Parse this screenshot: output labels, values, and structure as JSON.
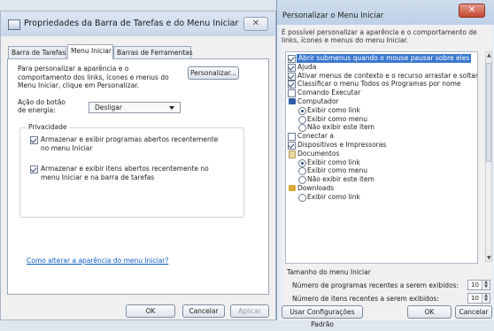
{
  "taskbar_dialog": {
    "title": "Propriedades da Barra de Tarefas e do Menu Iniciar",
    "close": "✕",
    "tabs": [
      "Barra de Tarefas",
      "Menu Iniciar",
      "Barras de Ferramentas"
    ],
    "intro": "Para personalizar a aparência e o comportamento dos links, ícones e menus do Menu Iniciar, clique em Personalizar.",
    "customize_button": "Personalizar...",
    "power_label": "Ação do botão de energia:",
    "power_value": "Desligar",
    "privacy_title": "Privacidade",
    "privacy_opt1": "Armazenar e exibir programas abertos recentemente no menu Iniciar",
    "privacy_opt2": "Armazenar e exibir itens abertos recentemente no menu Iniciar e na barra de tarefas",
    "link": "Como alterar a aparência do menu Iniciar?",
    "ok": "OK",
    "cancel": "Cancelar",
    "apply": "Aplicar"
  },
  "customize_dialog": {
    "title": "Personalizar o Menu Iniciar",
    "close": "✕",
    "description": "É possível personalizar a aparência e o comportamento de links, ícones e menus do menu Iniciar.",
    "items": [
      {
        "type": "check",
        "checked": true,
        "text": "Abrir submenus quando o mouse pausar sobre eles",
        "selected": true
      },
      {
        "type": "check",
        "checked": true,
        "text": "Ajuda"
      },
      {
        "type": "check",
        "checked": true,
        "text": "Ativar menus de contexto e o recurso arrastar e soltar"
      },
      {
        "type": "check",
        "checked": true,
        "text": "Classificar o menu Todos os Programas por nome"
      },
      {
        "type": "check",
        "checked": false,
        "text": "Comando Executar"
      },
      {
        "type": "folder",
        "icon": "computer-icon",
        "text": "Computador"
      },
      {
        "type": "radio",
        "checked": true,
        "text": "Exibir como link"
      },
      {
        "type": "radio",
        "checked": false,
        "text": "Exibir como menu"
      },
      {
        "type": "radio",
        "checked": false,
        "text": "Não exibir este item"
      },
      {
        "type": "check",
        "checked": false,
        "text": "Conectar a"
      },
      {
        "type": "check",
        "checked": true,
        "text": "Dispositivos e Impressoras"
      },
      {
        "type": "folder",
        "icon": "documents-icon",
        "text": "Documentos"
      },
      {
        "type": "radio",
        "checked": true,
        "text": "Exibir como link"
      },
      {
        "type": "radio",
        "checked": false,
        "text": "Exibir como menu"
      },
      {
        "type": "radio",
        "checked": false,
        "text": "Não exibir este item"
      },
      {
        "type": "folder",
        "icon": "downloads-icon",
        "text": "Downloads"
      },
      {
        "type": "radio",
        "checked": false,
        "text": "Exibir como link"
      }
    ],
    "size_title": "Tamanho do menu Iniciar",
    "recent_programs_label": "Número de programas recentes a serem exibidos:",
    "recent_programs_value": "10",
    "recent_items_label": "Número de itens recentes a serem exibidos:",
    "recent_items_value": "10",
    "defaults_button": "Usar Configurações Padrão",
    "ok": "OK",
    "cancel": "Cancelar"
  }
}
